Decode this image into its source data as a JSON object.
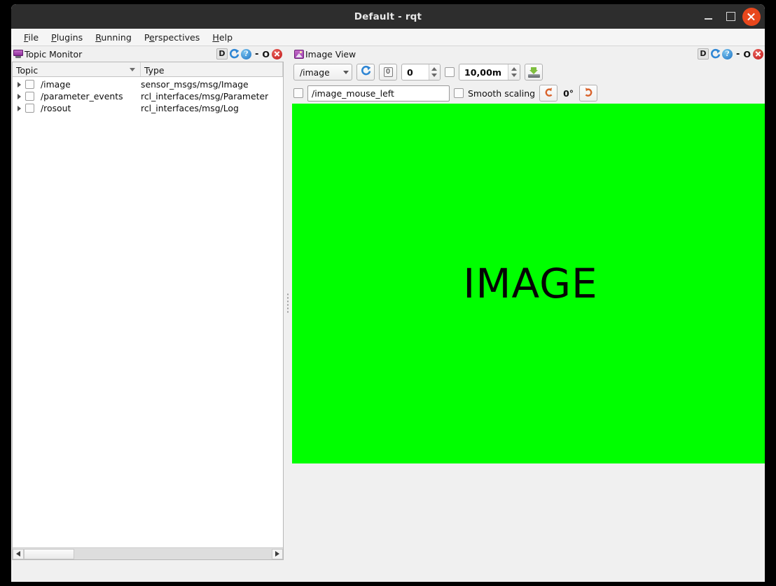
{
  "window": {
    "title": "Default - rqt",
    "controls": {
      "minimize": "minimize-icon",
      "maximize": "maximize-icon",
      "close": "close-icon"
    }
  },
  "menubar": {
    "items": [
      {
        "pre": "",
        "mn": "F",
        "post": "ile"
      },
      {
        "pre": "",
        "mn": "P",
        "post": "lugins"
      },
      {
        "pre": "",
        "mn": "R",
        "post": "unning"
      },
      {
        "pre": "P",
        "mn": "e",
        "post": "rspectives"
      },
      {
        "pre": "",
        "mn": "H",
        "post": "elp"
      }
    ]
  },
  "topic_monitor": {
    "title": "Topic Monitor",
    "icon": "monitor-icon",
    "dock_controls": {
      "d_label": "D",
      "reload": "reload-icon",
      "help": "?",
      "dash": "-",
      "float": "O",
      "close": "close-icon"
    },
    "columns": [
      "Topic",
      "Type"
    ],
    "rows": [
      {
        "topic": "/image",
        "type": "sensor_msgs/msg/Image",
        "checked": false
      },
      {
        "topic": "/parameter_events",
        "type": "rcl_interfaces/msg/Parameter",
        "checked": false
      },
      {
        "topic": "/rosout",
        "type": "rcl_interfaces/msg/Log",
        "checked": false
      }
    ]
  },
  "image_view": {
    "title": "Image View",
    "icon": "image-view-icon",
    "dock_controls": {
      "d_label": "D",
      "reload": "reload-icon",
      "help": "?",
      "dash": "-",
      "float": "O",
      "close": "close-icon"
    },
    "toolbar_row1": {
      "topic_combo_value": "/image",
      "refresh_icon": "refresh-icon",
      "index_icon": "index-icon",
      "index_value": "0",
      "range_checkbox": false,
      "range_value": "10,00m",
      "save_icon": "save-image-icon"
    },
    "toolbar_row2": {
      "publish_click_checkbox": false,
      "mouse_topic_value": "/image_mouse_left",
      "smooth_scaling_checkbox": false,
      "smooth_scaling_label": "Smooth scaling",
      "rotate_left_icon": "rotate-left-icon",
      "rotation_value": "0°",
      "rotate_right_icon": "rotate-right-icon"
    },
    "canvas": {
      "image_color": "#00ff00",
      "image_text": "IMAGE"
    }
  },
  "colors": {
    "titlebar_bg": "#2d2d2d",
    "window_bg": "#f0f0f0",
    "close_button": "#e8471c",
    "image_green": "#00ff00",
    "accent_blue": "#1a72c4",
    "accent_orange": "#d9622b",
    "dock_close_red": "#c2181a"
  }
}
